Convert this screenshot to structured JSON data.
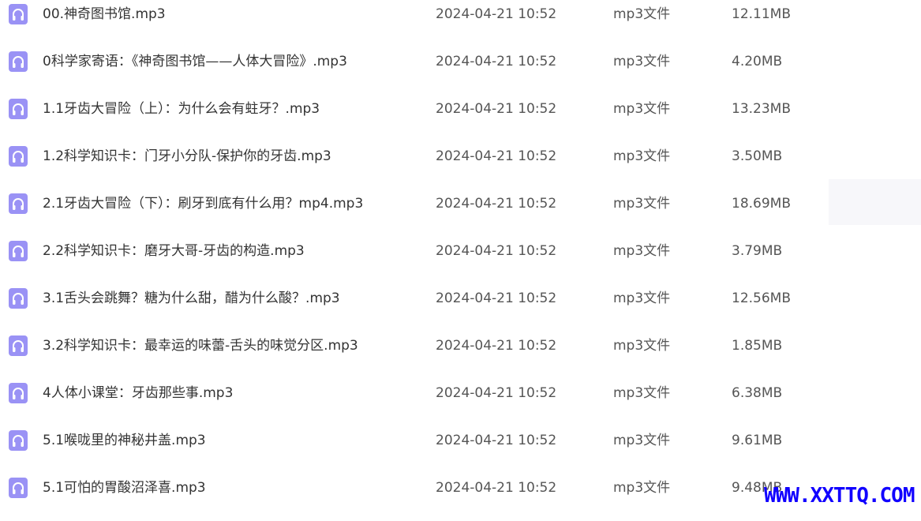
{
  "file_icon": {
    "name": "headphones-icon",
    "color": "#9a92f5"
  },
  "files": [
    {
      "name": "00.神奇图书馆.mp3",
      "modified": "2024-04-21 10:52",
      "type": "mp3文件",
      "size": "12.11MB"
    },
    {
      "name": "0科学家寄语：《神奇图书馆——人体大冒险》.mp3",
      "modified": "2024-04-21 10:52",
      "type": "mp3文件",
      "size": "4.20MB"
    },
    {
      "name": "1.1牙齿大冒险（上）：为什么会有蛀牙？.mp3",
      "modified": "2024-04-21 10:52",
      "type": "mp3文件",
      "size": "13.23MB"
    },
    {
      "name": "1.2科学知识卡：门牙小分队-保护你的牙齿.mp3",
      "modified": "2024-04-21 10:52",
      "type": "mp3文件",
      "size": "3.50MB"
    },
    {
      "name": "2.1牙齿大冒险（下）：刷牙到底有什么用？mp4.mp3",
      "modified": "2024-04-21 10:52",
      "type": "mp3文件",
      "size": "18.69MB"
    },
    {
      "name": "2.2科学知识卡：磨牙大哥-牙齿的构造.mp3",
      "modified": "2024-04-21 10:52",
      "type": "mp3文件",
      "size": "3.79MB"
    },
    {
      "name": "3.1舌头会跳舞？糖为什么甜，醋为什么酸？.mp3",
      "modified": "2024-04-21 10:52",
      "type": "mp3文件",
      "size": "12.56MB"
    },
    {
      "name": "3.2科学知识卡：最幸运的味蕾-舌头的味觉分区.mp3",
      "modified": "2024-04-21 10:52",
      "type": "mp3文件",
      "size": "1.85MB"
    },
    {
      "name": "4人体小课堂：牙齿那些事.mp3",
      "modified": "2024-04-21 10:52",
      "type": "mp3文件",
      "size": "6.38MB"
    },
    {
      "name": "5.1喉咙里的神秘井盖.mp3",
      "modified": "2024-04-21 10:52",
      "type": "mp3文件",
      "size": "9.61MB"
    },
    {
      "name": "5.1可怕的胃酸沼泽喜.mp3",
      "modified": "2024-04-21 10:52",
      "type": "mp3文件",
      "size": "9.48MB"
    }
  ],
  "watermark": "WWW.XXTTQ.COM"
}
